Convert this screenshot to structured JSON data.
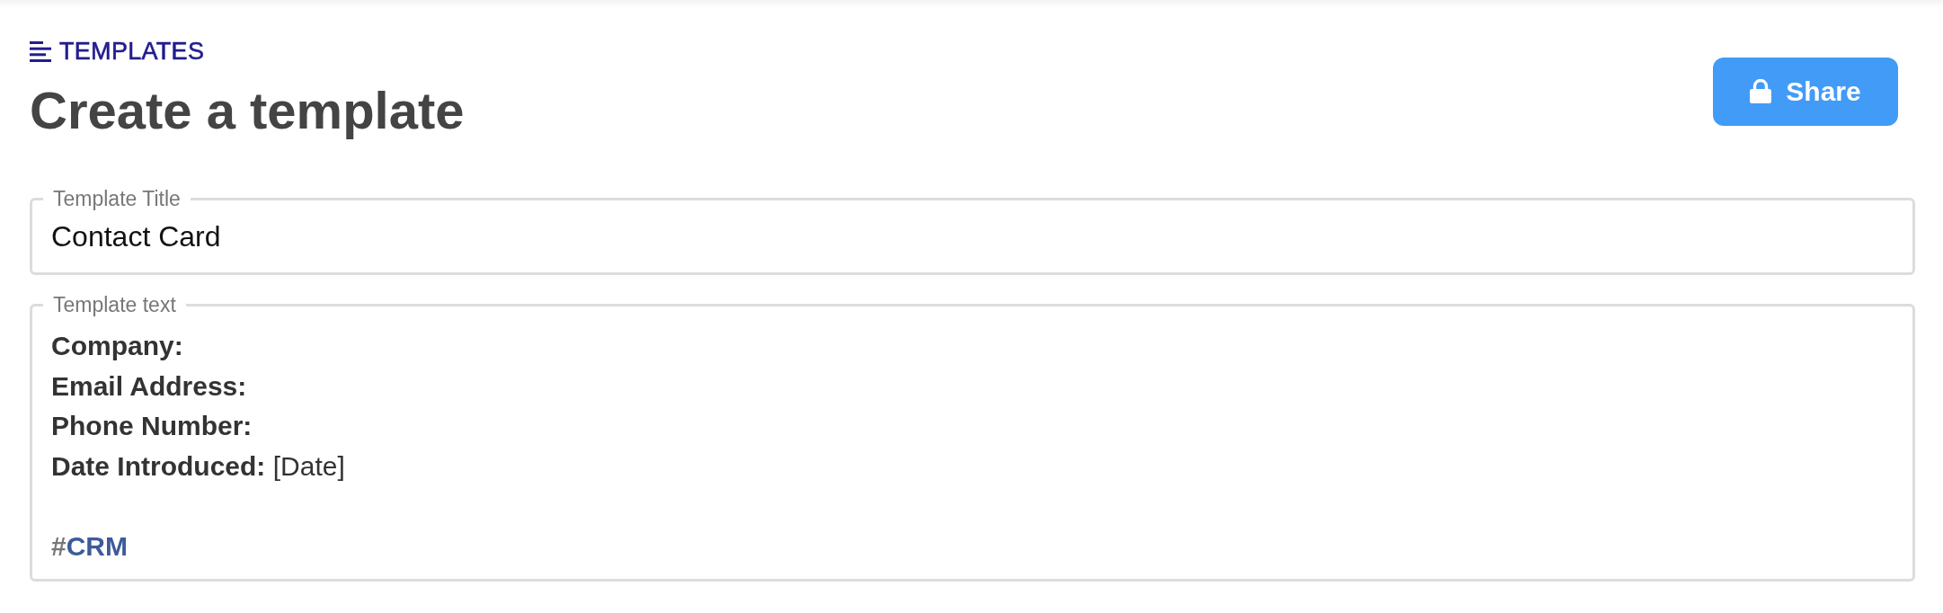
{
  "breadcrumb": {
    "label": "TEMPLATES"
  },
  "page_title": "Create a template",
  "share_button": {
    "label": "Share"
  },
  "fields": [
    {
      "kind": "input",
      "label": "Template Title",
      "value": "Contact Card"
    },
    {
      "kind": "rich_text",
      "label": "Template text",
      "lines": [
        {
          "label": "Company:"
        },
        {
          "label": "Email Address:"
        },
        {
          "label": "Phone Number:"
        },
        {
          "label": "Date Introduced:",
          "value": "[Date]"
        }
      ],
      "tags": [
        {
          "prefix": "#",
          "name": "CRM"
        }
      ]
    }
  ]
}
